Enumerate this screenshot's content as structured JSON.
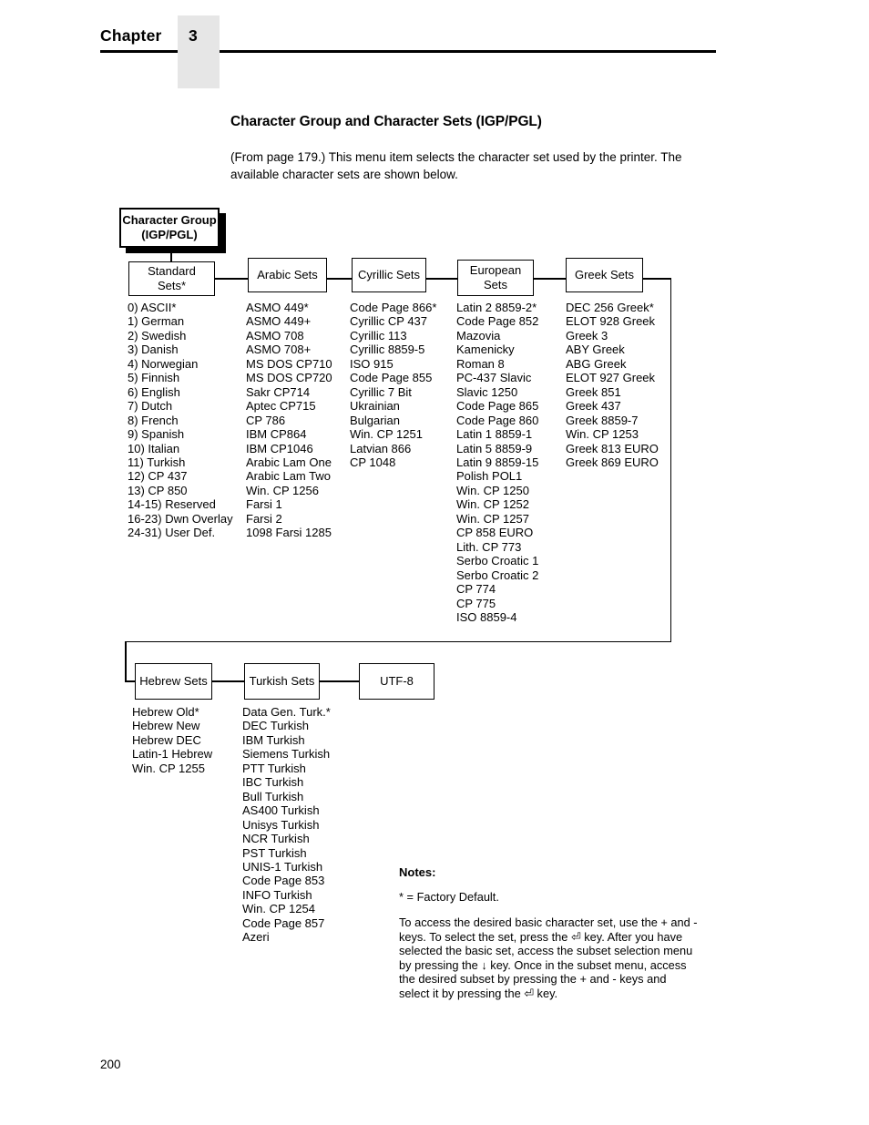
{
  "header": {
    "chapter_label": "Chapter",
    "chapter_number": "3"
  },
  "title": "Character Group and Character Sets (IGP/PGL)",
  "intro": "(From page 179.) This menu item selects the character set used by the printer. The available character sets are shown below.",
  "diagram": {
    "root": {
      "line1": "Character Group",
      "line2": "(IGP/PGL)"
    },
    "nodes": [
      {
        "label": "Standard Sets*",
        "line1": "Standard",
        "line2": "Sets*"
      },
      {
        "label": "Arabic Sets",
        "line1": "Arabic Sets",
        "line2": ""
      },
      {
        "label": "Cyrillic Sets",
        "line1": "Cyrillic Sets",
        "line2": ""
      },
      {
        "label": "European Sets",
        "line1": "European",
        "line2": "Sets"
      },
      {
        "label": "Greek Sets",
        "line1": "Greek Sets",
        "line2": ""
      },
      {
        "label": "Hebrew Sets",
        "line1": "Hebrew Sets",
        "line2": ""
      },
      {
        "label": "Turkish Sets",
        "line1": "Turkish Sets",
        "line2": ""
      },
      {
        "label": "UTF-8",
        "line1": "UTF-8",
        "line2": ""
      }
    ]
  },
  "sets": {
    "standard": [
      "0) ASCII*",
      "1) German",
      "2) Swedish",
      "3) Danish",
      "4) Norwegian",
      "5) Finnish",
      "6) English",
      "7) Dutch",
      "8) French",
      "9) Spanish",
      "10) Italian",
      "11) Turkish",
      "12) CP 437",
      "13) CP 850",
      "14-15) Reserved",
      "16-23) Dwn Overlay",
      "24-31) User Def."
    ],
    "arabic": [
      "ASMO 449*",
      "ASMO 449+",
      "ASMO 708",
      "ASMO 708+",
      "MS DOS CP710",
      "MS DOS CP720",
      "Sakr CP714",
      "Aptec CP715",
      "CP 786",
      "IBM CP864",
      "IBM CP1046",
      "Arabic Lam One",
      "Arabic Lam Two",
      "Win. CP 1256",
      "Farsi 1",
      "Farsi 2",
      "1098 Farsi 1285"
    ],
    "cyrillic": [
      "Code Page 866*",
      "Cyrillic CP 437",
      "Cyrillic 113",
      "Cyrillic 8859-5",
      "ISO 915",
      "Code Page 855",
      "Cyrillic 7 Bit",
      "Ukrainian",
      "Bulgarian",
      "Win. CP 1251",
      "Latvian 866",
      "CP 1048"
    ],
    "european": [
      "Latin 2 8859-2*",
      "Code Page 852",
      "Mazovia",
      "Kamenicky",
      "Roman 8",
      "PC-437 Slavic",
      "Slavic 1250",
      "Code Page 865",
      "Code Page 860",
      "Latin 1 8859-1",
      "Latin 5 8859-9",
      "Latin 9 8859-15",
      "Polish POL1",
      "Win. CP 1250",
      "Win. CP 1252",
      "Win. CP 1257",
      "CP 858 EURO",
      "Lith. CP 773",
      "Serbo Croatic 1",
      "Serbo Croatic 2",
      "CP 774",
      "CP 775",
      "ISO 8859-4"
    ],
    "greek": [
      "DEC 256 Greek*",
      "ELOT 928 Greek",
      "Greek 3",
      "ABY Greek",
      "ABG Greek",
      "ELOT 927 Greek",
      "Greek 851",
      "Greek 437",
      "Greek 8859-7",
      "Win. CP 1253",
      "Greek 813 EURO",
      "Greek 869 EURO"
    ],
    "hebrew": [
      "Hebrew Old*",
      "Hebrew New",
      "Hebrew DEC",
      "Latin-1 Hebrew",
      "Win. CP 1255"
    ],
    "turkish": [
      "Data Gen. Turk.*",
      "DEC Turkish",
      "IBM Turkish",
      "Siemens Turkish",
      "PTT Turkish",
      "IBC Turkish",
      "Bull Turkish",
      "AS400 Turkish",
      "Unisys Turkish",
      "NCR Turkish",
      "PST Turkish",
      "UNIS-1 Turkish",
      "Code Page 853",
      "INFO Turkish",
      "Win. CP 1254",
      "Code Page 857",
      "Azeri"
    ]
  },
  "notes": {
    "heading": "Notes:",
    "factory_default": "* = Factory Default.",
    "body": "To access the desired basic character set, use the + and - keys. To select the set, press the ⏎ key. After you have selected the basic set, access the subset selection menu by pressing the ↓ key. Once in the subset menu, access the desired subset by pressing the + and - keys and select it by pressing the ⏎ key."
  },
  "footer": {
    "page_number": "200"
  }
}
